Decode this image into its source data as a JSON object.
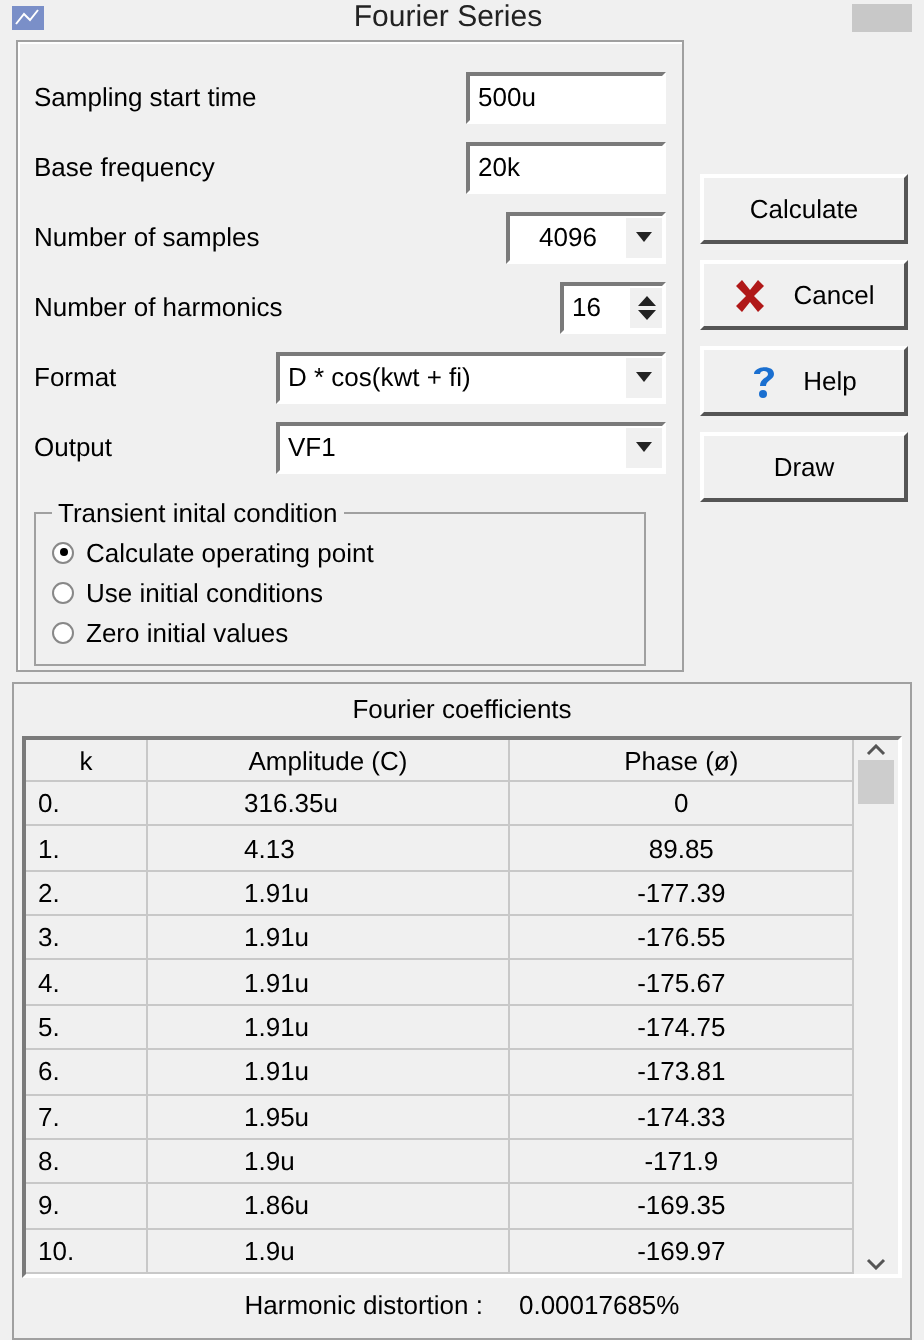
{
  "window": {
    "title": "Fourier Series"
  },
  "fields": [
    {
      "kind": "text",
      "label": "Sampling start time",
      "value": "500u"
    },
    {
      "kind": "text",
      "label": "Base frequency",
      "value": "20k"
    },
    {
      "kind": "combo",
      "label": "Number of samples",
      "value": "4096"
    },
    {
      "kind": "spin",
      "label": "Number of harmonics",
      "value": "16"
    },
    {
      "kind": "wide-combo",
      "label": "Format",
      "value": "D * cos(kwt + fi)"
    },
    {
      "kind": "wide-combo",
      "label": "Output",
      "value": "VF1"
    }
  ],
  "initial_condition": {
    "title": "Transient inital condition",
    "options": [
      {
        "label": "Calculate operating point",
        "selected": true
      },
      {
        "label": "Use initial conditions",
        "selected": false
      },
      {
        "label": "Zero initial values",
        "selected": false
      }
    ]
  },
  "buttons": [
    {
      "kind": "plain",
      "label": "Calculate"
    },
    {
      "kind": "cancel",
      "label": "Cancel"
    },
    {
      "kind": "help",
      "label": "Help"
    },
    {
      "kind": "plain",
      "label": "Draw"
    }
  ],
  "coefficients": {
    "title": "Fourier coefficients",
    "columns": [
      "k",
      "Amplitude (C)",
      "Phase (ø)"
    ],
    "rows": [
      [
        "0.",
        "316.35u",
        "0"
      ],
      [
        "1.",
        "4.13",
        "89.85"
      ],
      [
        "2.",
        "1.91u",
        "-177.39"
      ],
      [
        "3.",
        "1.91u",
        "-176.55"
      ],
      [
        "4.",
        "1.91u",
        "-175.67"
      ],
      [
        "5.",
        "1.91u",
        "-174.75"
      ],
      [
        "6.",
        "1.91u",
        "-173.81"
      ],
      [
        "7.",
        "1.95u",
        "-174.33"
      ],
      [
        "8.",
        "1.9u",
        "-171.9"
      ],
      [
        "9.",
        "1.86u",
        "-169.35"
      ],
      [
        "10.",
        "1.9u",
        "-169.97"
      ]
    ]
  },
  "status": {
    "label": "Harmonic distortion :",
    "value": "0.00017685%"
  }
}
